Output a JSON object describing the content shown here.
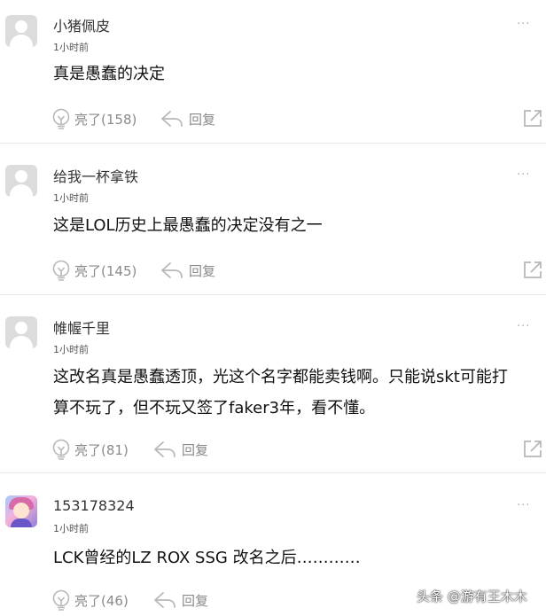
{
  "comments": [
    {
      "username": "小猪佩皮",
      "time": "1小时前",
      "content_lines": [
        "真是愚蠢的决定"
      ],
      "like_label": "亮了(158)",
      "reply_label": "回复",
      "avatar": "default-avatar-icon"
    },
    {
      "username": "给我一杯拿铁",
      "time": "1小时前",
      "content_lines": [
        "这是LOL历史上最愚蠢的决定没有之一"
      ],
      "like_label": "亮了(145)",
      "reply_label": "回复",
      "avatar": "default-avatar-icon"
    },
    {
      "username": "帷幄千里",
      "time": "1小时前",
      "content_lines": [
        "这改名真是愚蠢透顶，光这个名字都能卖钱啊。只能说skt可能打",
        "算不玩了，但不玩又签了faker3年，看不懂。"
      ],
      "like_label": "亮了(81)",
      "reply_label": "回复",
      "avatar": "default-avatar-icon"
    },
    {
      "username": "153178324",
      "time": "1小时前",
      "content_lines": [
        "LCK曾经的LZ ROX SSG 改名之后…………"
      ],
      "like_label": "亮了(46)",
      "reply_label": "回复",
      "avatar": "anime-girl-avatar"
    }
  ],
  "more_glyph": "···",
  "watermark": "头条 @游有王木木",
  "colors": {
    "action_gray": "#8a8a8a",
    "divider": "#e9e9e9"
  }
}
